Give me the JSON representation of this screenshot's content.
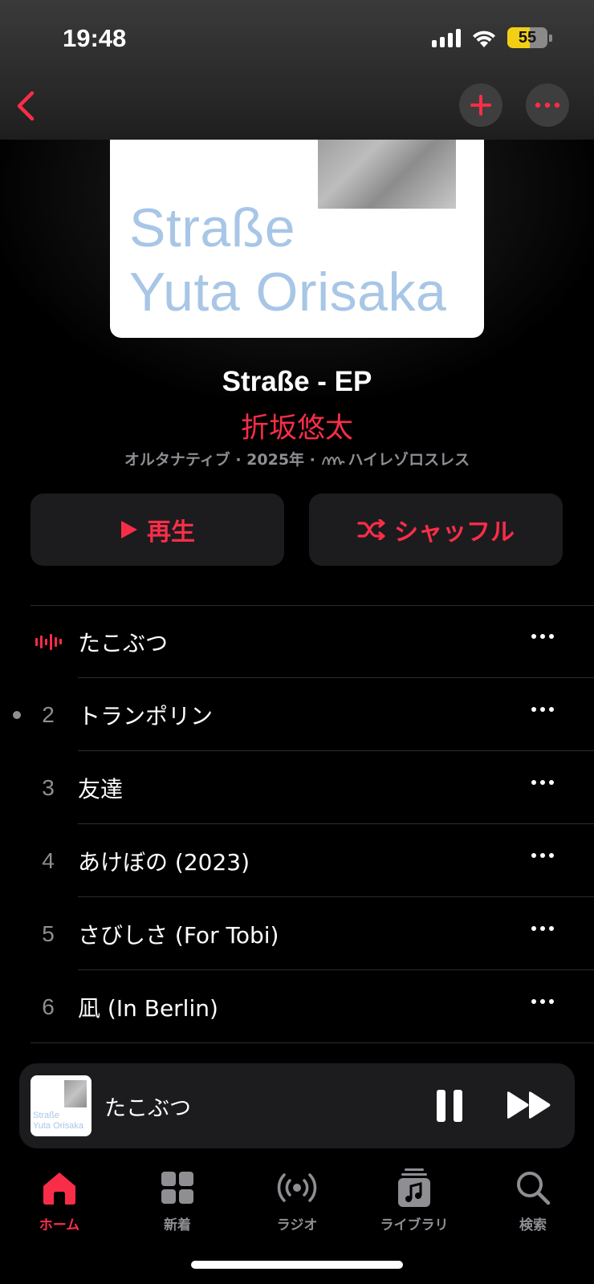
{
  "status_bar": {
    "time": "19:48",
    "battery_level": "55",
    "icons": [
      "signal-icon",
      "wifi-icon",
      "battery-icon"
    ]
  },
  "nav": {
    "icons": [
      "chevron-left-icon",
      "plus-icon",
      "ellipsis-icon"
    ]
  },
  "album": {
    "art_line1": "Straße",
    "art_line2": "Yuta Orisaka",
    "title": "Straße - EP",
    "artist": "折坂悠太",
    "meta_prefix": "オルタナティブ · 2025年 · ",
    "meta_quality": "ハイレゾロスレス"
  },
  "actions": {
    "play_label": "再生",
    "shuffle_label": "シャッフル"
  },
  "tracks": [
    {
      "number": "",
      "title": "たこぶつ",
      "state": "playing"
    },
    {
      "number": "2",
      "title": "トランポリン",
      "state": "unplayed-dot"
    },
    {
      "number": "3",
      "title": "友達",
      "state": ""
    },
    {
      "number": "4",
      "title": "あけぼの (2023)",
      "state": ""
    },
    {
      "number": "5",
      "title": "さびしさ (For Tobi)",
      "state": ""
    },
    {
      "number": "6",
      "title": "凪 (In Berlin)",
      "state": ""
    }
  ],
  "mini_player": {
    "title": "たこぶつ",
    "art_line1": "Straße",
    "art_line2": "Yuta Orisaka"
  },
  "tabs": [
    {
      "label": "ホーム",
      "icon": "home-icon",
      "active": true
    },
    {
      "label": "新着",
      "icon": "grid-icon",
      "active": false
    },
    {
      "label": "ラジオ",
      "icon": "radio-icon",
      "active": false
    },
    {
      "label": "ライブラリ",
      "icon": "library-icon",
      "active": false
    },
    {
      "label": "検索",
      "icon": "search-icon",
      "active": false
    }
  ],
  "colors": {
    "accent": "#fa2d48",
    "background": "#000000",
    "surface": "#1c1c1e",
    "secondary_text": "#8e8e93",
    "album_text": "#a8c6e6",
    "battery": "#f2cf15"
  }
}
